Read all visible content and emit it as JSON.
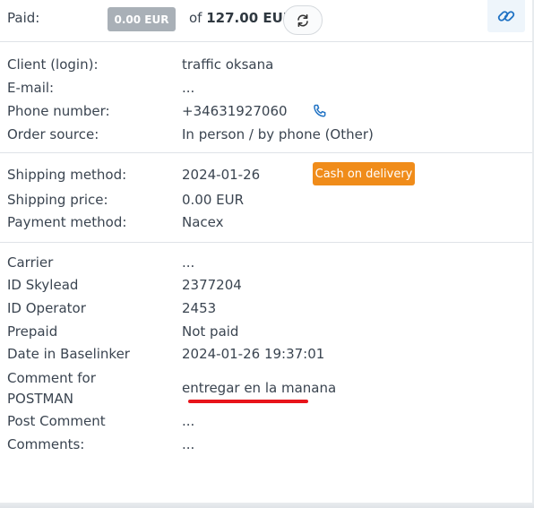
{
  "paid": {
    "label": "Paid:",
    "amount_badge": "0.00 EUR",
    "of_prefix": "of",
    "total": "127.00 EUR",
    "refresh_icon": "refresh-icon",
    "link_icon": "link-icon"
  },
  "client_section": [
    {
      "label": "Client (login):",
      "value": "traffic oksana"
    },
    {
      "label": "E-mail:",
      "value": "..."
    },
    {
      "label": "Phone number:",
      "value": "+34631927060"
    },
    {
      "label": "Order source:",
      "value": "In person / by phone (Other)"
    }
  ],
  "shipping_section": [
    {
      "label": "Shipping method:",
      "value": "2024-01-26"
    },
    {
      "label": "Shipping price:",
      "value": "0.00 EUR"
    },
    {
      "label": "Payment method:",
      "value": "Nacex"
    }
  ],
  "cash_badge": "Cash on delivery",
  "details_section": [
    {
      "label": "Carrier",
      "value": "..."
    },
    {
      "label": "ID Skylead",
      "value": "2377204"
    },
    {
      "label": "ID Operator",
      "value": "2453"
    },
    {
      "label": "Prepaid",
      "value": "Not paid"
    },
    {
      "label": "Date in Baselinker",
      "value": "2024-01-26 19:37:01"
    },
    {
      "label": "Comment for POSTMAN",
      "value": "entregar en la manana"
    },
    {
      "label": "Post Comment",
      "value": "..."
    },
    {
      "label": "Comments:",
      "value": "..."
    }
  ],
  "colors": {
    "accent": "#1f72c4",
    "cash_badge": "#f08c1a",
    "paid_badge": "#a9b0b7",
    "underline": "#e8141b"
  }
}
